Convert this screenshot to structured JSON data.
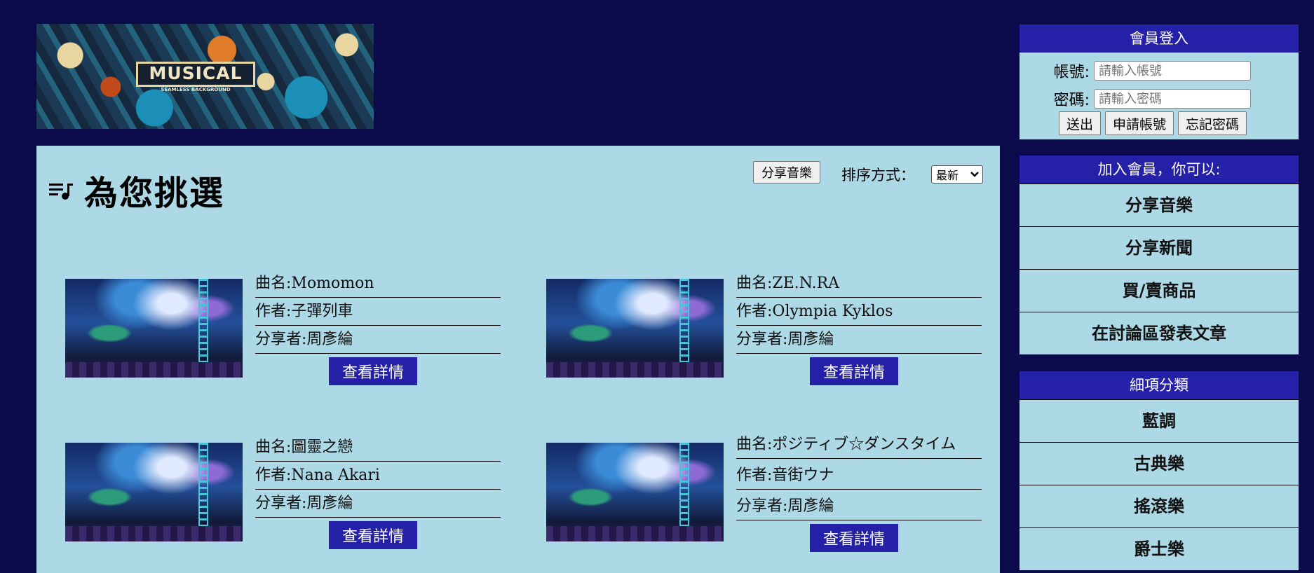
{
  "banner": {
    "title": "MUSICAL",
    "subtitle": "SEAMLESS BACKGROUND"
  },
  "main": {
    "heading": "為您挑選",
    "share_button": "分享音樂",
    "sort_label": "排序方式：",
    "sort_selected": "最新",
    "songs": [
      {
        "title": "曲名:Momomon",
        "author": "作者:子彈列車",
        "sharer": "分享者:周彥綸",
        "button": "查看詳情"
      },
      {
        "title": "曲名:ZE.N.RA",
        "author": "作者:Olympia Kyklos",
        "sharer": "分享者:周彥綸",
        "button": "查看詳情"
      },
      {
        "title": "曲名:圖靈之戀",
        "author": "作者:Nana Akari",
        "sharer": "分享者:周彥綸",
        "button": "查看詳情"
      },
      {
        "title": "曲名:ポジティブ☆ダンスタイム",
        "author": "作者:音街ウナ",
        "sharer": "分享者:周彥綸",
        "button": "查看詳情"
      }
    ]
  },
  "login": {
    "heading": "會員登入",
    "account_label": "帳號:",
    "account_placeholder": "請輸入帳號",
    "password_label": "密碼:",
    "password_placeholder": "請輸入密碼",
    "submit": "送出",
    "register": "申請帳號",
    "forgot": "忘記密碼"
  },
  "join": {
    "heading": "加入會員，你可以:",
    "items": [
      "分享音樂",
      "分享新聞",
      "買/賣商品",
      "在討論區發表文章"
    ]
  },
  "categories": {
    "heading": "細項分類",
    "items": [
      "藍調",
      "古典樂",
      "搖滾樂",
      "爵士樂"
    ]
  },
  "colors": {
    "background": "#0b0a4a",
    "panel": "#add8e6",
    "accent": "#2420a8"
  }
}
